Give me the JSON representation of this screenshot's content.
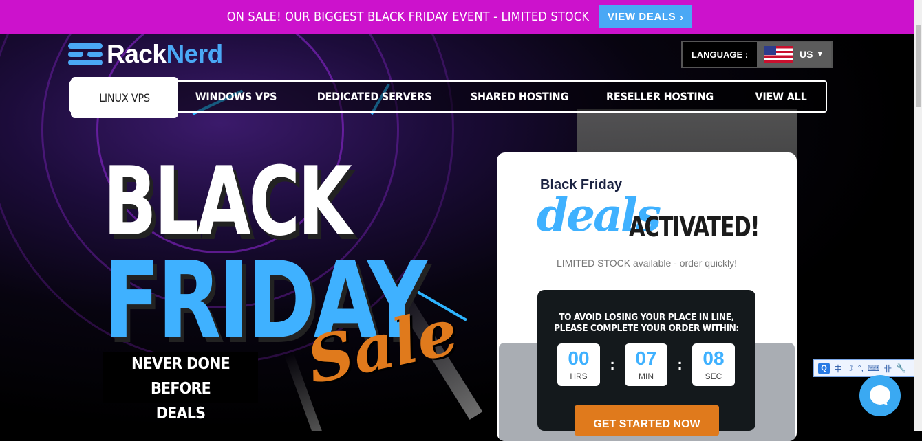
{
  "topbar": {
    "promo": "ON SALE! OUR BIGGEST BLACK FRIDAY EVENT - LIMITED STOCK",
    "cta": "VIEW DEALS"
  },
  "logo": {
    "part1": "Rack",
    "part2": "Nerd"
  },
  "language": {
    "label": "LANGUAGE :",
    "value": "US"
  },
  "nav": {
    "items": [
      {
        "label": "LINUX VPS"
      },
      {
        "label": "WINDOWS VPS"
      },
      {
        "label": "DEDICATED SERVERS"
      },
      {
        "label": "SHARED HOSTING"
      },
      {
        "label": "RESELLER HOSTING"
      },
      {
        "label": "VIEW ALL"
      }
    ]
  },
  "hero": {
    "line1": "BLACK",
    "line2": "FRIDAY",
    "script": "Sale",
    "tagline1": "NEVER DONE BEFORE",
    "tagline2": "DEALS"
  },
  "card": {
    "small": "Black Friday",
    "script": "deals",
    "activated": "ACTIVATED!",
    "limited": "LIMITED STOCK available - order quickly!",
    "avoid1": "TO AVOID LOSING YOUR PLACE IN LINE,",
    "avoid2": "PLEASE COMPLETE YOUR ORDER WITHIN:",
    "hrs": "00",
    "hrs_label": "HRS",
    "min": "07",
    "min_label": "MIN",
    "sec": "08",
    "sec_label": "SEC",
    "cta": "GET STARTED NOW"
  },
  "ime": {
    "items": [
      "中",
      "☽",
      "°,",
      "⌨",
      "卝",
      "🔧"
    ]
  },
  "colors": {
    "accent": "#3fb1ff",
    "promo_bar": "#cc12cc",
    "orange": "#e07a1c"
  }
}
